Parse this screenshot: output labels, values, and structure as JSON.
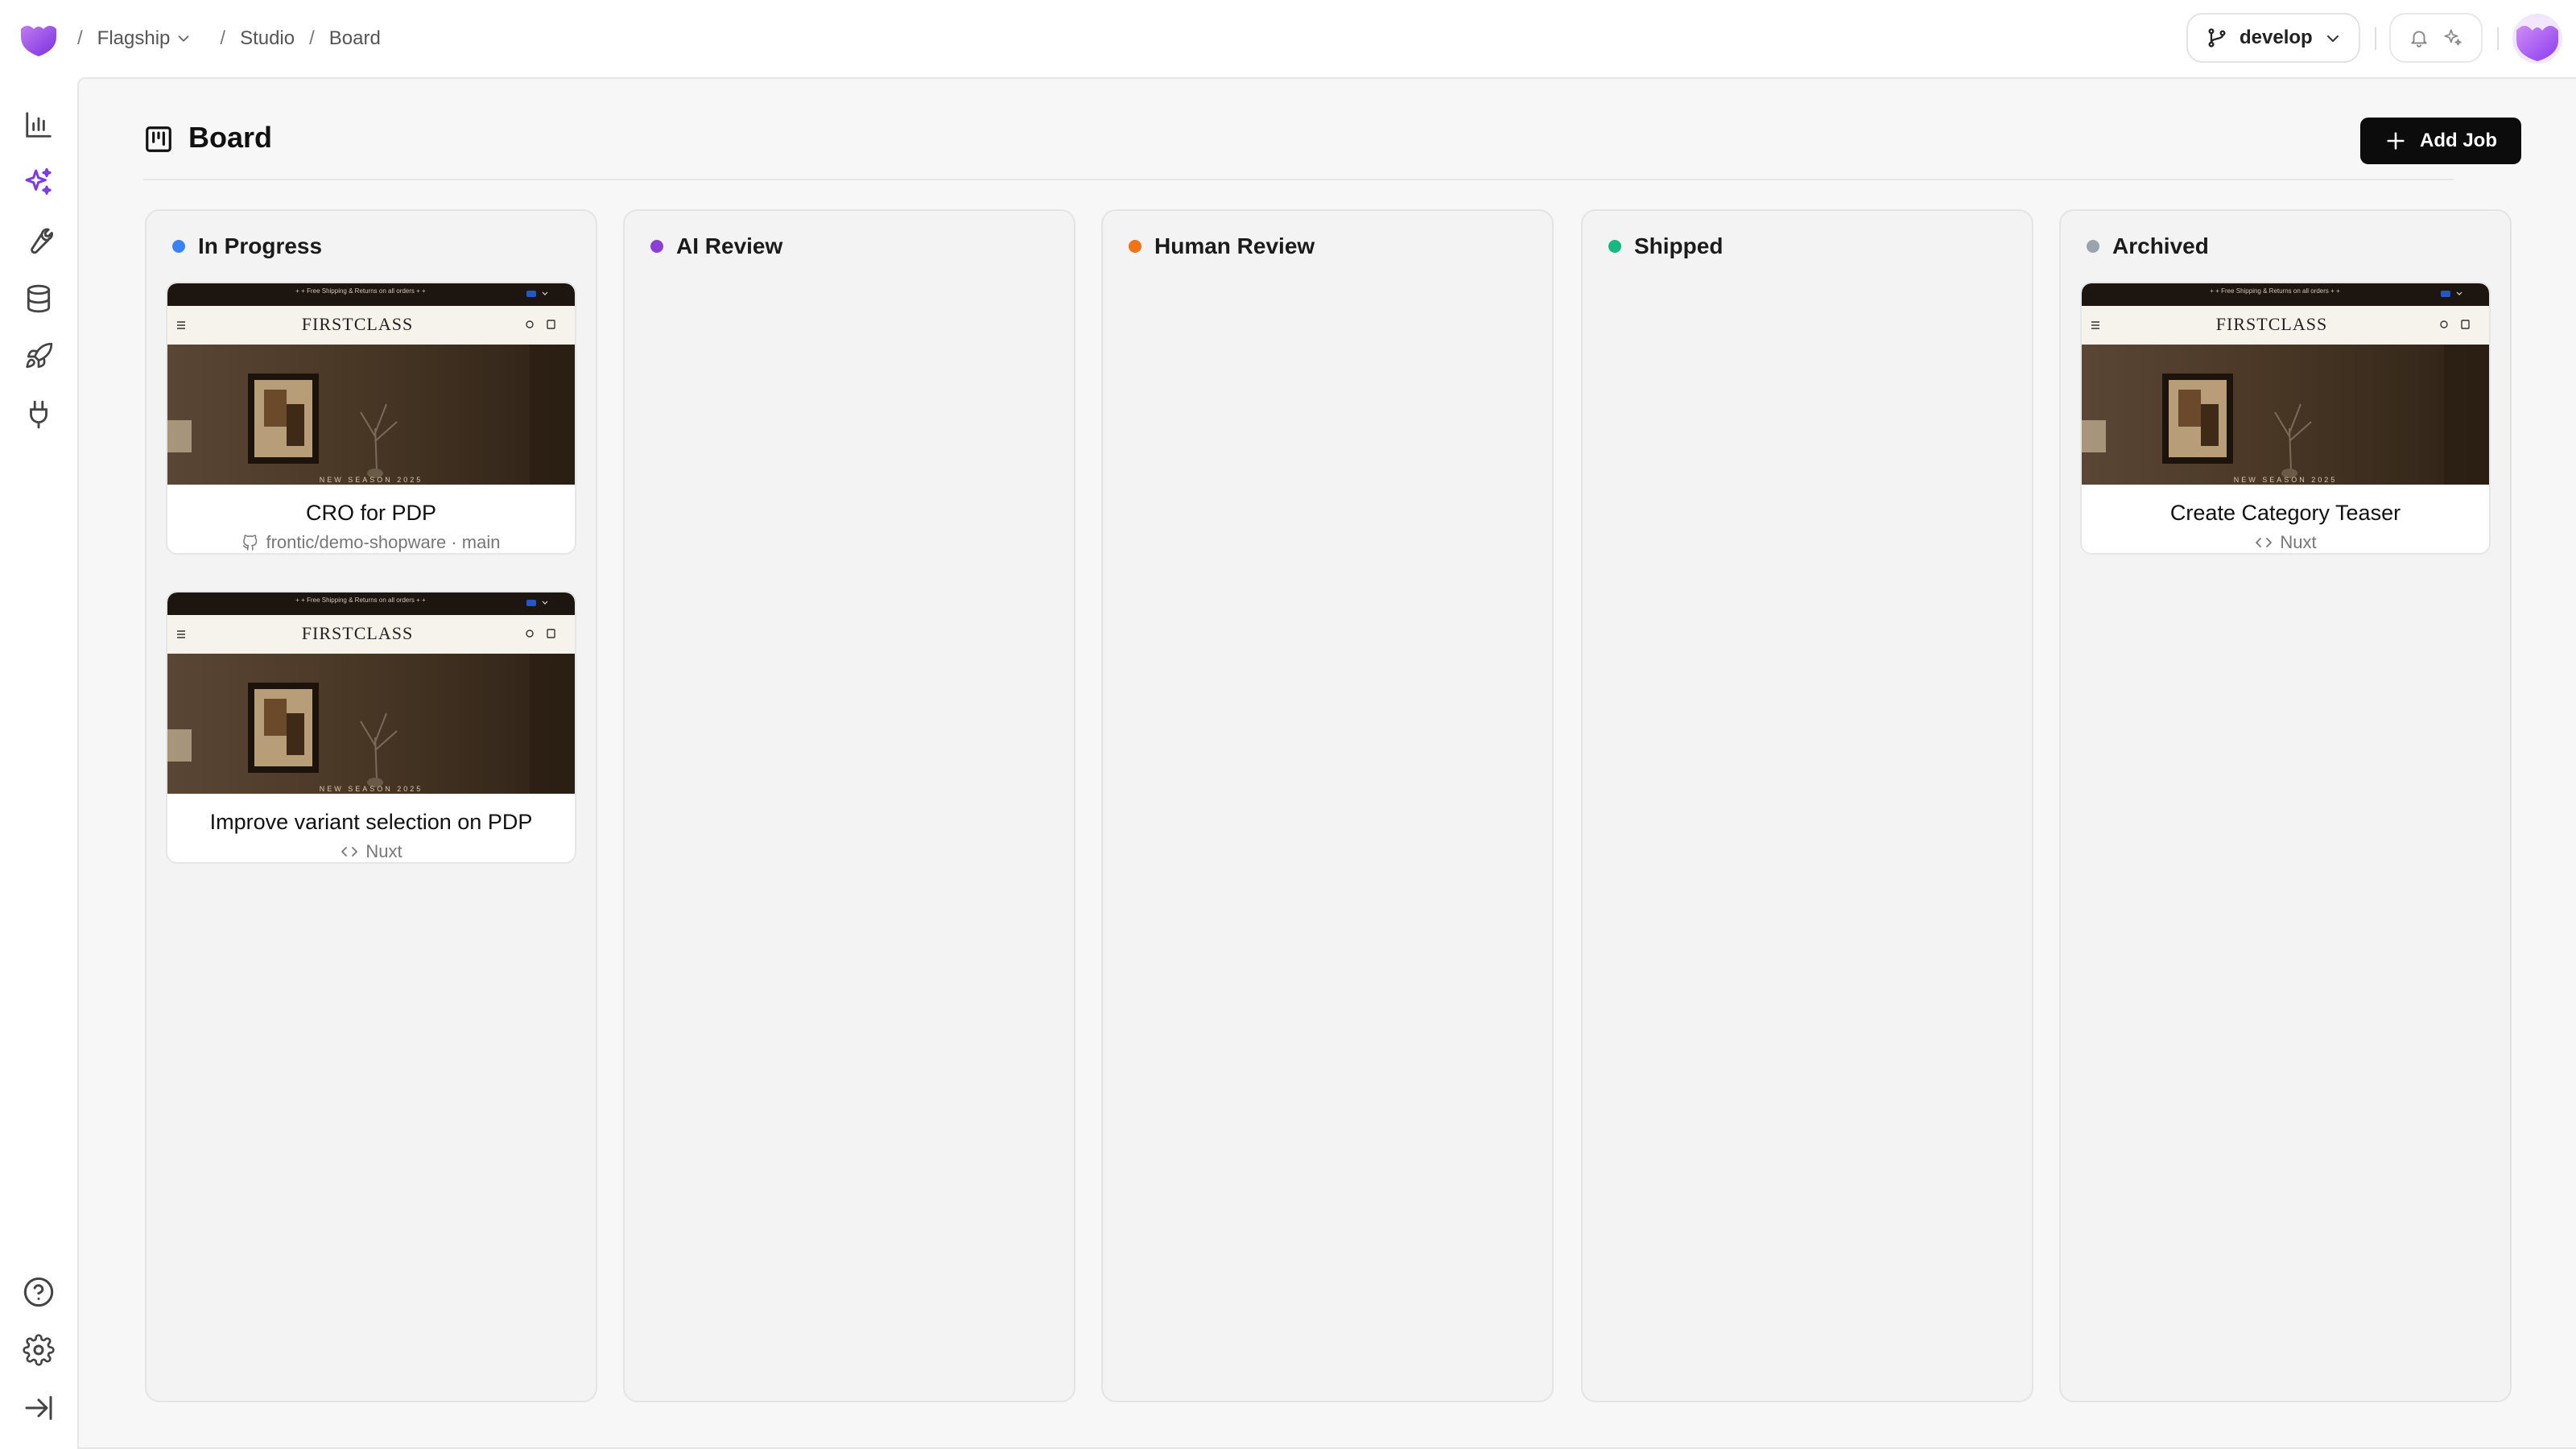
{
  "breadcrumb": {
    "org": "Flagship",
    "section": "Studio",
    "page": "Board"
  },
  "branch": {
    "label": "develop"
  },
  "page": {
    "title": "Board",
    "add_job_label": "Add Job"
  },
  "columns": [
    {
      "name": "In Progress",
      "color": "#3b82f6"
    },
    {
      "name": "AI Review",
      "color": "#8b3fd9"
    },
    {
      "name": "Human Review",
      "color": "#f07316"
    },
    {
      "name": "Shipped",
      "color": "#14b880"
    },
    {
      "name": "Archived",
      "color": "#9ca3af"
    }
  ],
  "cards": [
    {
      "title": "CRO for PDP",
      "subtitle": "frontic/demo-shopware · main",
      "sub_icon": "github-icon"
    },
    {
      "title": "Improve variant selection on PDP",
      "subtitle": "Nuxt",
      "sub_icon": "code-icon"
    },
    {
      "title": "Create Category Teaser",
      "subtitle": "Nuxt",
      "sub_icon": "code-icon"
    }
  ],
  "thumbnail": {
    "promo_text": "+ + Free Shipping & Returns on all orders + +",
    "brand": "FIRSTCLASS",
    "hero_caption": "NEW SEASON 2025"
  }
}
